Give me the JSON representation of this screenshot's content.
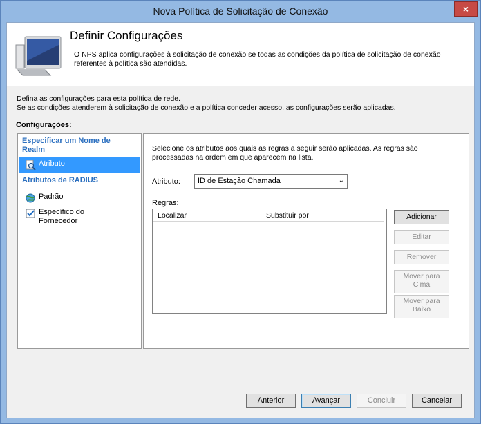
{
  "window": {
    "title": "Nova Política de Solicitação de Conexão",
    "close_icon": "×"
  },
  "header": {
    "title": "Definir Configurações",
    "description": "O NPS aplica configurações à solicitação de conexão se todas as condições da política de solicitação de conexão referentes à política são atendidas."
  },
  "intro": {
    "line1": "Defina as configurações para esta política de rede.",
    "line2": "Se as condições atenderem à solicitação de conexão e a política conceder acesso, as configurações serão aplicadas."
  },
  "configurations_label": "Configurações:",
  "sidebar": {
    "group1": "Especificar um Nome de Realm",
    "group1_items": [
      {
        "label": "Atributo",
        "icon": "magnifier-document-icon",
        "selected": true
      }
    ],
    "group2": "Atributos de RADIUS",
    "group2_items": [
      {
        "label": "Padrão",
        "icon": "globe-icon"
      },
      {
        "label": "Específico do Fornecedor",
        "icon": "checkbox-document-icon"
      }
    ]
  },
  "main": {
    "description": "Selecione os atributos aos quais as regras a seguir serão aplicadas. As regras são processadas na ordem em que aparecem na lista.",
    "attribute_label": "Atributo:",
    "attribute_value": "ID de Estação Chamada",
    "rules_label": "Regras:",
    "columns": [
      "Localizar",
      "Substituir por"
    ],
    "buttons": {
      "add": "Adicionar",
      "edit": "Editar",
      "remove": "Remover",
      "move_up": "Mover para Cima",
      "move_down": "Mover para Baixo"
    }
  },
  "footer": {
    "previous": "Anterior",
    "next": "Avançar",
    "finish": "Concluir",
    "cancel": "Cancelar"
  }
}
